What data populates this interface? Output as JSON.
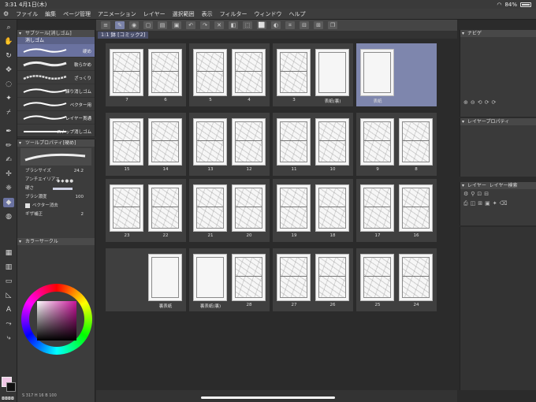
{
  "status": {
    "time": "3:31",
    "date": "4月1日(木)",
    "battery": "84%"
  },
  "menu": [
    "ファイル",
    "編集",
    "ページ管理",
    "アニメーション",
    "レイヤー",
    "選択範囲",
    "表示",
    "フィルター",
    "ウィンドウ",
    "ヘルプ"
  ],
  "tab": {
    "label": "1:1 鉢 [コミック2]"
  },
  "subtool": {
    "title": "サブツール[消しゴム]",
    "tab": "消しゴム",
    "items": [
      "硬め",
      "軟らかめ",
      "ざっくり",
      "練り消しゴム",
      "ベクター用",
      "レイヤー貫通",
      "スナップ消しゴム"
    ],
    "active_index": 0
  },
  "toolprop": {
    "title": "ツールプロパティ[硬め]",
    "brush_size_label": "ブラシサイズ",
    "brush_size": "24.2",
    "antialias_label": "アンチエイリアス",
    "hardness_label": "硬さ",
    "density_label": "ブラシ濃度",
    "density": "100",
    "vector_erase_label": "ベクター消去",
    "vector_erase_checked": true,
    "correction_label": "ギザ補正",
    "correction": "2"
  },
  "colorpanel": {
    "title": "カラーサークル",
    "footer": "S 317 H 16 B 100"
  },
  "rpanels": {
    "navigator": "ナビゲ",
    "layer_property": "レイヤープロパティ",
    "layer": "レイヤー",
    "layer_search": "レイヤー検索"
  },
  "pages": [
    {
      "labels": [
        "7",
        "6"
      ],
      "sketch": true
    },
    {
      "labels": [
        "5",
        "4"
      ],
      "sketch": true
    },
    {
      "labels": [
        "3",
        "表紙(裏)"
      ],
      "sketch": [
        true,
        false
      ]
    },
    {
      "labels": [
        "表紙"
      ],
      "sketch": false,
      "selected": true
    },
    {
      "labels": [
        "15",
        "14"
      ],
      "sketch": true
    },
    {
      "labels": [
        "13",
        "12"
      ],
      "sketch": true
    },
    {
      "labels": [
        "11",
        "10"
      ],
      "sketch": true
    },
    {
      "labels": [
        "9",
        "8"
      ],
      "sketch": true
    },
    {
      "labels": [
        "23",
        "22"
      ],
      "sketch": true
    },
    {
      "labels": [
        "21",
        "20"
      ],
      "sketch": true
    },
    {
      "labels": [
        "19",
        "18"
      ],
      "sketch": true
    },
    {
      "labels": [
        "17",
        "16"
      ],
      "sketch": true
    },
    {
      "labels": [
        "裏表紙"
      ],
      "sketch": false
    },
    {
      "labels": [
        "裏表紙(裏)",
        "28"
      ],
      "sketch": [
        false,
        true
      ]
    },
    {
      "labels": [
        "27",
        "26"
      ],
      "sketch": true
    },
    {
      "labels": [
        "25",
        "24"
      ],
      "sketch": true
    }
  ],
  "tools": [
    "search-icon",
    "hand-icon",
    "rotate-icon",
    "move-icon",
    "lasso-icon",
    "magic-wand-icon",
    "eyedropper-icon",
    "pen-icon",
    "pencil-icon",
    "brush-icon",
    "airbrush-icon",
    "decoration-icon",
    "eraser-icon",
    "fill-icon",
    "gradient-icon",
    "frame-icon",
    "ruler-icon",
    "text-icon",
    "balloon-icon",
    "correction-icon"
  ],
  "active_tool_index": 12
}
